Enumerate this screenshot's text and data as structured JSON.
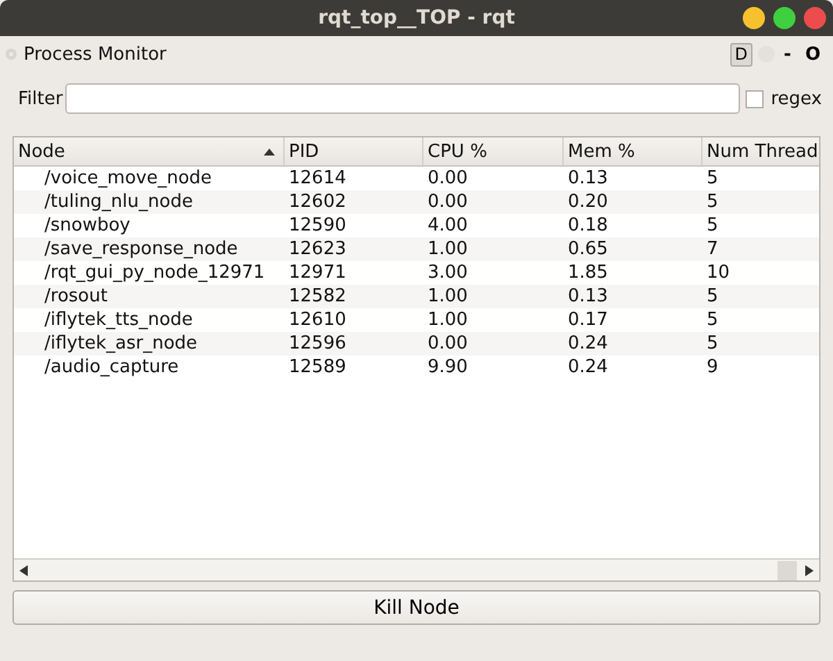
{
  "window": {
    "title": "rqt_top__TOP - rqt"
  },
  "plugin": {
    "title": "Process Monitor",
    "buttons": [
      "D",
      "-",
      "O"
    ]
  },
  "filter": {
    "label": "Filter",
    "regex": {
      "label": "regex",
      "checked": false
    }
  },
  "table": {
    "columns": [
      "Node",
      "PID",
      "CPU %",
      "Mem %",
      "Num Thread"
    ],
    "rows": [
      [
        "/voice_move_node",
        "12614",
        "0.00",
        "0.13",
        "5"
      ],
      [
        "/tuling_nlu_node",
        "12602",
        "0.00",
        "0.20",
        "5"
      ],
      [
        "/snowboy",
        "12590",
        "4.00",
        "0.18",
        "5"
      ],
      [
        "/save_response_node",
        "12623",
        "1.00",
        "0.65",
        "7"
      ],
      [
        "/rqt_gui_py_node_12971",
        "12971",
        "3.00",
        "1.85",
        "10"
      ],
      [
        "/rosout",
        "12582",
        "1.00",
        "0.13",
        "5"
      ],
      [
        "/iflytek_tts_node",
        "12610",
        "1.00",
        "0.17",
        "5"
      ],
      [
        "/iflytek_asr_node",
        "12596",
        "0.00",
        "0.24",
        "5"
      ],
      [
        "/audio_capture",
        "12589",
        "9.90",
        "0.24",
        "9"
      ]
    ]
  },
  "kill_button": "Kill Node"
}
